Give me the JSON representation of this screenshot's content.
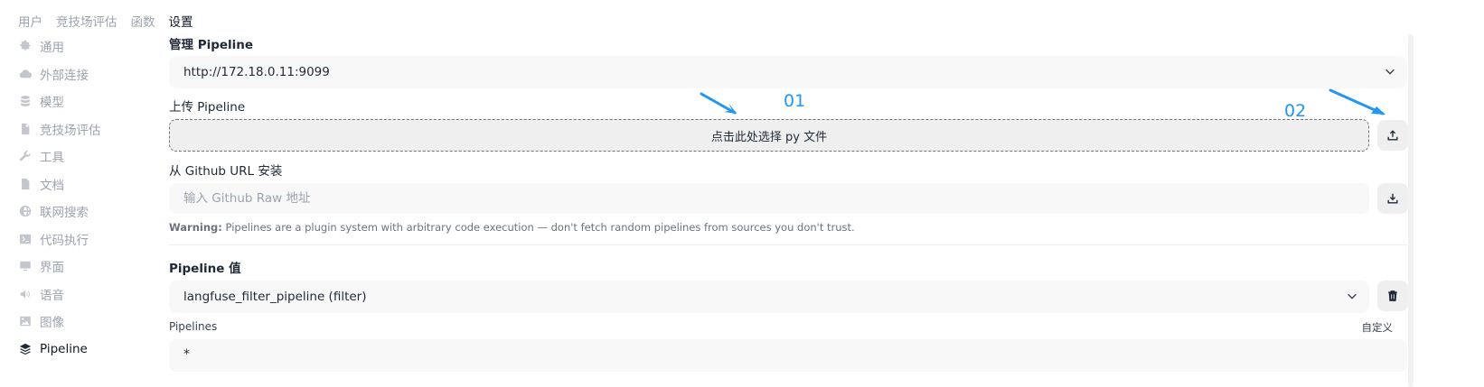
{
  "topnav": [
    {
      "label": "用户",
      "active": false
    },
    {
      "label": "竞技场评估",
      "active": false
    },
    {
      "label": "函数",
      "active": false
    },
    {
      "label": "设置",
      "active": true
    }
  ],
  "sidebar": {
    "items": [
      {
        "label": "通用",
        "icon": "gear-icon"
      },
      {
        "label": "外部连接",
        "icon": "cloud-icon"
      },
      {
        "label": "模型",
        "icon": "database-icon"
      },
      {
        "label": "竞技场评估",
        "icon": "document-icon"
      },
      {
        "label": "工具",
        "icon": "wrench-icon"
      },
      {
        "label": "文档",
        "icon": "document-text-icon"
      },
      {
        "label": "联网搜索",
        "icon": "globe-icon"
      },
      {
        "label": "代码执行",
        "icon": "terminal-icon"
      },
      {
        "label": "界面",
        "icon": "monitor-icon"
      },
      {
        "label": "语音",
        "icon": "speaker-icon"
      },
      {
        "label": "图像",
        "icon": "image-icon"
      },
      {
        "label": "Pipeline",
        "icon": "layers-icon",
        "active": true
      }
    ]
  },
  "manage": {
    "title": "管理 Pipeline",
    "selected_url": "http://172.18.0.11:9099"
  },
  "upload": {
    "title": "上传 Pipeline",
    "dropzone_label": "点击此处选择 py 文件"
  },
  "github": {
    "title": "从 Github URL 安装",
    "placeholder": "输入 Github Raw 地址"
  },
  "warning": {
    "prefix": "Warning:",
    "text": " Pipelines are a plugin system with arbitrary code execution — don't fetch random pipelines from sources you don't trust."
  },
  "pipeline_value": {
    "title": "Pipeline 值",
    "selected": "langfuse_filter_pipeline (filter)",
    "pipelines_label": "Pipelines",
    "custom_label": "自定义",
    "pipelines_value": "*"
  },
  "annotations": {
    "label1": "01",
    "label2": "02",
    "color": "#2196f3"
  }
}
